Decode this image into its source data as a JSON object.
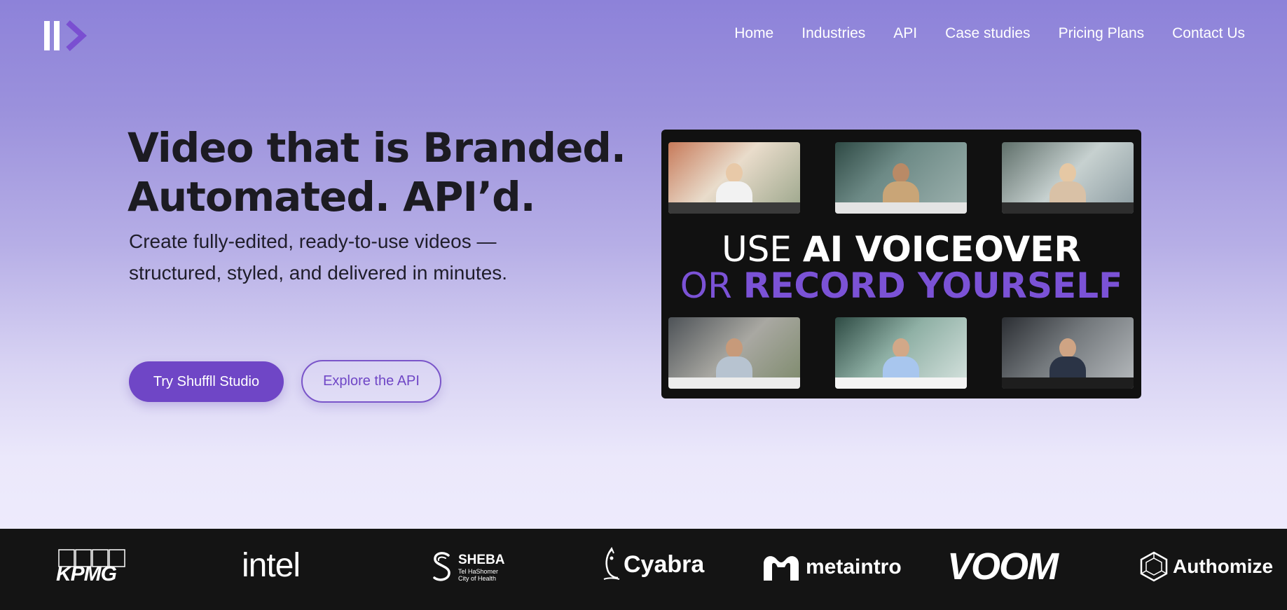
{
  "nav": {
    "logo": "logo",
    "links": [
      "Home",
      "Industries",
      "API",
      "Case studies",
      "Pricing Plans",
      "Contact Us"
    ]
  },
  "hero": {
    "title_line1": "Video that is Branded.",
    "title_line2": "Automated. API’d.",
    "subtitle_line1": "Create fully-edited, ready-to-use videos —",
    "subtitle_line2": "structured, styled, and delivered in minutes.",
    "primary_button": "Try Shuffll Studio",
    "secondary_button": "Explore the API"
  },
  "video": {
    "line1_light": "USE ",
    "line1_bold": "AI VOICEOVER",
    "line2_light": "OR ",
    "line2_bold": "RECORD YOURSELF"
  },
  "clients": {
    "kpmg": "KPMG",
    "intel": "intel",
    "sheba_name": "SHEBA",
    "sheba_tag1": "Tel HaShomer",
    "sheba_tag2": "City of Health",
    "cyabra": "Cyabra",
    "metaintro": "metaintro",
    "voom": "VOOM",
    "authomize": "Authomize"
  },
  "colors": {
    "accent": "#6f46c6",
    "strip": "#141414",
    "headline": "#1c1b22"
  }
}
